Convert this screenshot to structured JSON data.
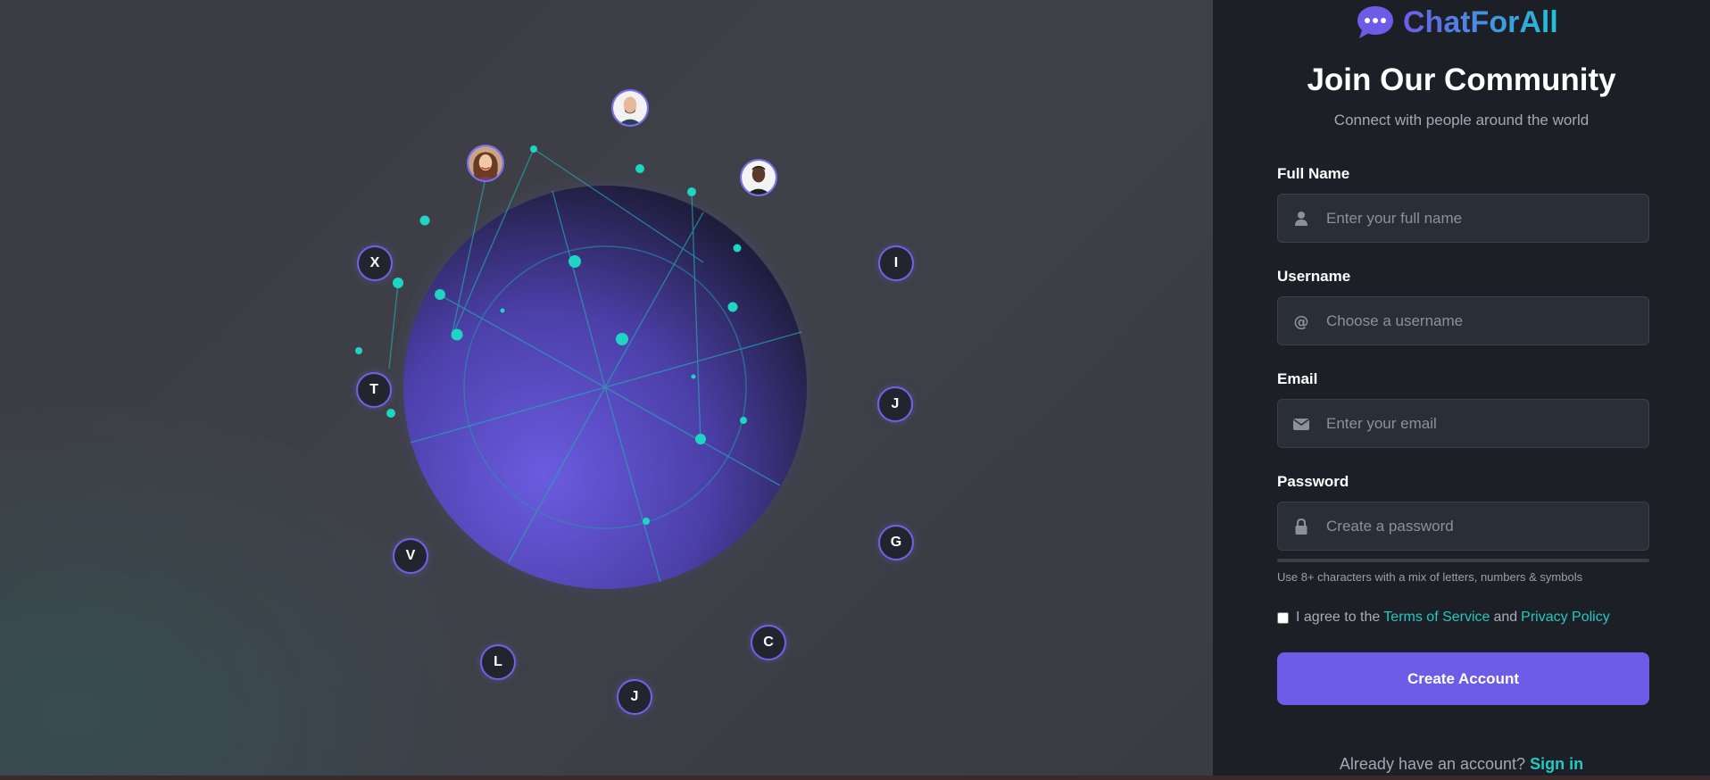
{
  "brand": {
    "name": "ChatForAll",
    "colors": {
      "primary": "#6c5ce7",
      "accent": "#22c9c1"
    }
  },
  "hero": {
    "node_letters": [
      "X",
      "T",
      "V",
      "L",
      "J",
      "C",
      "G",
      "J",
      "I"
    ],
    "avatar_icons": [
      "person-avatar",
      "person-avatar",
      "person-avatar"
    ]
  },
  "form": {
    "title": "Join Our Community",
    "subtitle": "Connect with people around the world",
    "fields": [
      {
        "label": "Full Name",
        "placeholder": "Enter your full name",
        "value": "",
        "icon": "user-icon"
      },
      {
        "label": "Username",
        "placeholder": "Choose a username",
        "value": "",
        "icon": "at-icon"
      },
      {
        "label": "Email",
        "placeholder": "Enter your email",
        "value": "",
        "icon": "envelope-icon"
      },
      {
        "label": "Password",
        "placeholder": "Create a password",
        "value": "",
        "icon": "lock-icon"
      }
    ],
    "password_hint": "Use 8+ characters with a mix of letters, numbers & symbols",
    "terms": {
      "prefix": "I agree to the",
      "tos_link": "Terms of Service",
      "conjunction": "and",
      "privacy_link": "Privacy Policy",
      "checked": false
    },
    "submit_label": "Create Account",
    "signin_prompt": "Already have an account?",
    "signin_link": "Sign in"
  }
}
